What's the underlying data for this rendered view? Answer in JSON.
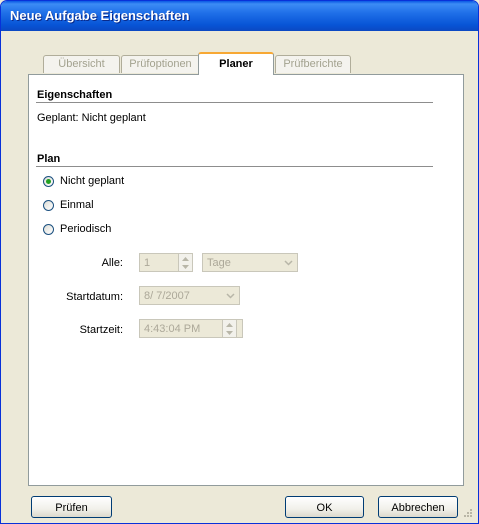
{
  "window": {
    "title": "Neue Aufgabe Eigenschaften"
  },
  "tabs": [
    {
      "label": "Übersicht",
      "active": false
    },
    {
      "label": "Prüfoptionen",
      "active": false
    },
    {
      "label": "Planer",
      "active": true
    },
    {
      "label": "Prüfberichte",
      "active": false
    }
  ],
  "properties": {
    "heading": "Eigenschaften",
    "status_text": "Geplant: Nicht geplant"
  },
  "plan": {
    "heading": "Plan",
    "options": [
      {
        "label": "Nicht geplant",
        "checked": true
      },
      {
        "label": "Einmal",
        "checked": false
      },
      {
        "label": "Periodisch",
        "checked": false
      }
    ],
    "alle_label": "Alle:",
    "alle_value": "1",
    "unit_value": "Tage",
    "startdatum_label": "Startdatum:",
    "startdatum_value": "8/ 7/2007",
    "startzeit_label": "Startzeit:",
    "startzeit_value": "4:43:04 PM"
  },
  "buttons": {
    "check": "Prüfen",
    "ok": "OK",
    "cancel": "Abbrechen"
  },
  "colors": {
    "titlebar": "#0754d6",
    "active_tab_accent": "#f7a834",
    "radio_selected": "#21a121",
    "disabled_text": "#aca899"
  }
}
